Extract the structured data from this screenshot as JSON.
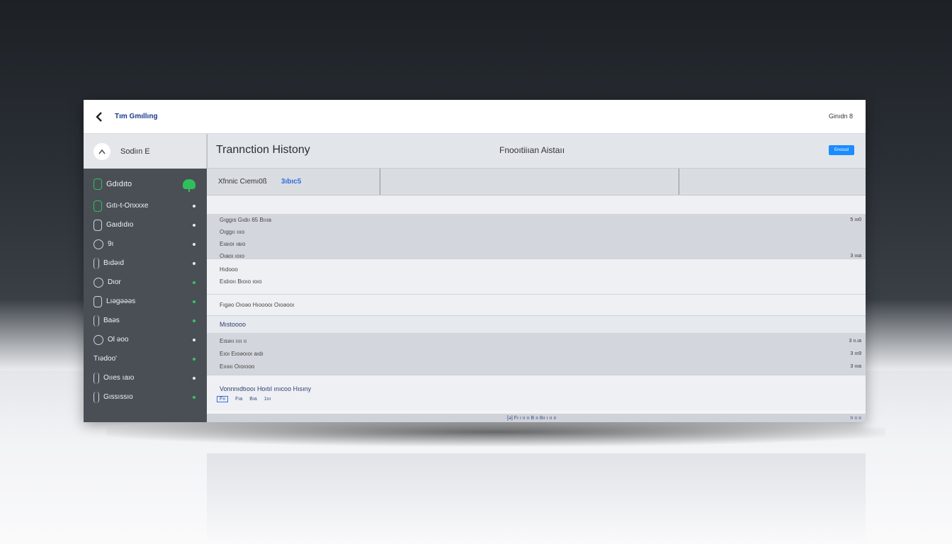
{
  "topbar": {
    "app_title": "Tım Gmıllıng",
    "right_text": "Ginıdn 8"
  },
  "sidebar": {
    "header_label": "Sodiın E",
    "items": [
      {
        "label": "Gdıdıto",
        "icon": "wallet-icon",
        "active": true
      },
      {
        "label": "Gıtı-t-Onxxxe",
        "icon": "card-icon"
      },
      {
        "label": "Gaıdıdıo",
        "icon": "folder-icon"
      },
      {
        "label": "9ı",
        "icon": "clock-icon"
      },
      {
        "label": "Bıdəıd",
        "icon": "bar-icon"
      },
      {
        "label": "Dıor",
        "icon": "circle-icon"
      },
      {
        "label": "Lıəgəəəs",
        "icon": "bracket-icon"
      },
      {
        "label": "Baəs",
        "icon": "bar-icon"
      },
      {
        "label": "Ol əoo",
        "icon": "circle-icon"
      },
      {
        "label": "Tıədoo'",
        "icon": "none"
      },
      {
        "label": "Oııes ıaıo",
        "icon": "bar-icon"
      },
      {
        "label": "Gıssıssıo",
        "icon": "bar-icon"
      }
    ]
  },
  "main": {
    "title": "Trannction Histony",
    "header_mid": "Fnooıtiiıan Aistaıı",
    "header_button": "Enossd",
    "filter_label": "Xfnnic Cıemı0ß",
    "filter_value": "3ıbıc5",
    "groups": [
      {
        "style": "grey",
        "rows": [
          {
            "text": "Gıggıs Gıdıı 65 Bıııa",
            "amount": "5 ııı0"
          },
          {
            "text": "Oıggıı ıııo",
            "amount": ""
          },
          {
            "text": "Eıaıoı ıaıo",
            "amount": ""
          },
          {
            "text": "Oıaoı ıoıo",
            "amount": "3 ıııa"
          }
        ]
      },
      {
        "style": "light",
        "rows": [
          {
            "text": "Hıdooo",
            "amount": ""
          },
          {
            "text": "Eıdıoıı Bıoıo ıoıo",
            "amount": ""
          }
        ]
      },
      {
        "style": "light",
        "rows": [
          {
            "text": "Fıgəo Oıoəo Hıooooı Oıoəooı",
            "amount": ""
          }
        ]
      }
    ],
    "group2_title": "Mıstoooo",
    "group2_rows": [
      {
        "text": "Eısəıı ıııı ıı",
        "amount": "3 ıı.ıa"
      },
      {
        "text": "Eıoı Eıoəoıoı aıdı",
        "amount": "3 ııı9"
      },
      {
        "text": "Eııəıı Oıoıooo",
        "amount": "3 ıııa"
      }
    ],
    "footer_title": "Vonnnıdtıooı Hoıtıl ınıcoo Hısıny",
    "footer_tags": [
      "Fıı",
      "Fıa",
      "Bıa",
      "1ııı"
    ],
    "pager": "[ə] Fı ı ıı ıı B ıı 8ıı ı ıı ıı",
    "pager_right": "Iı ıı ıı"
  }
}
